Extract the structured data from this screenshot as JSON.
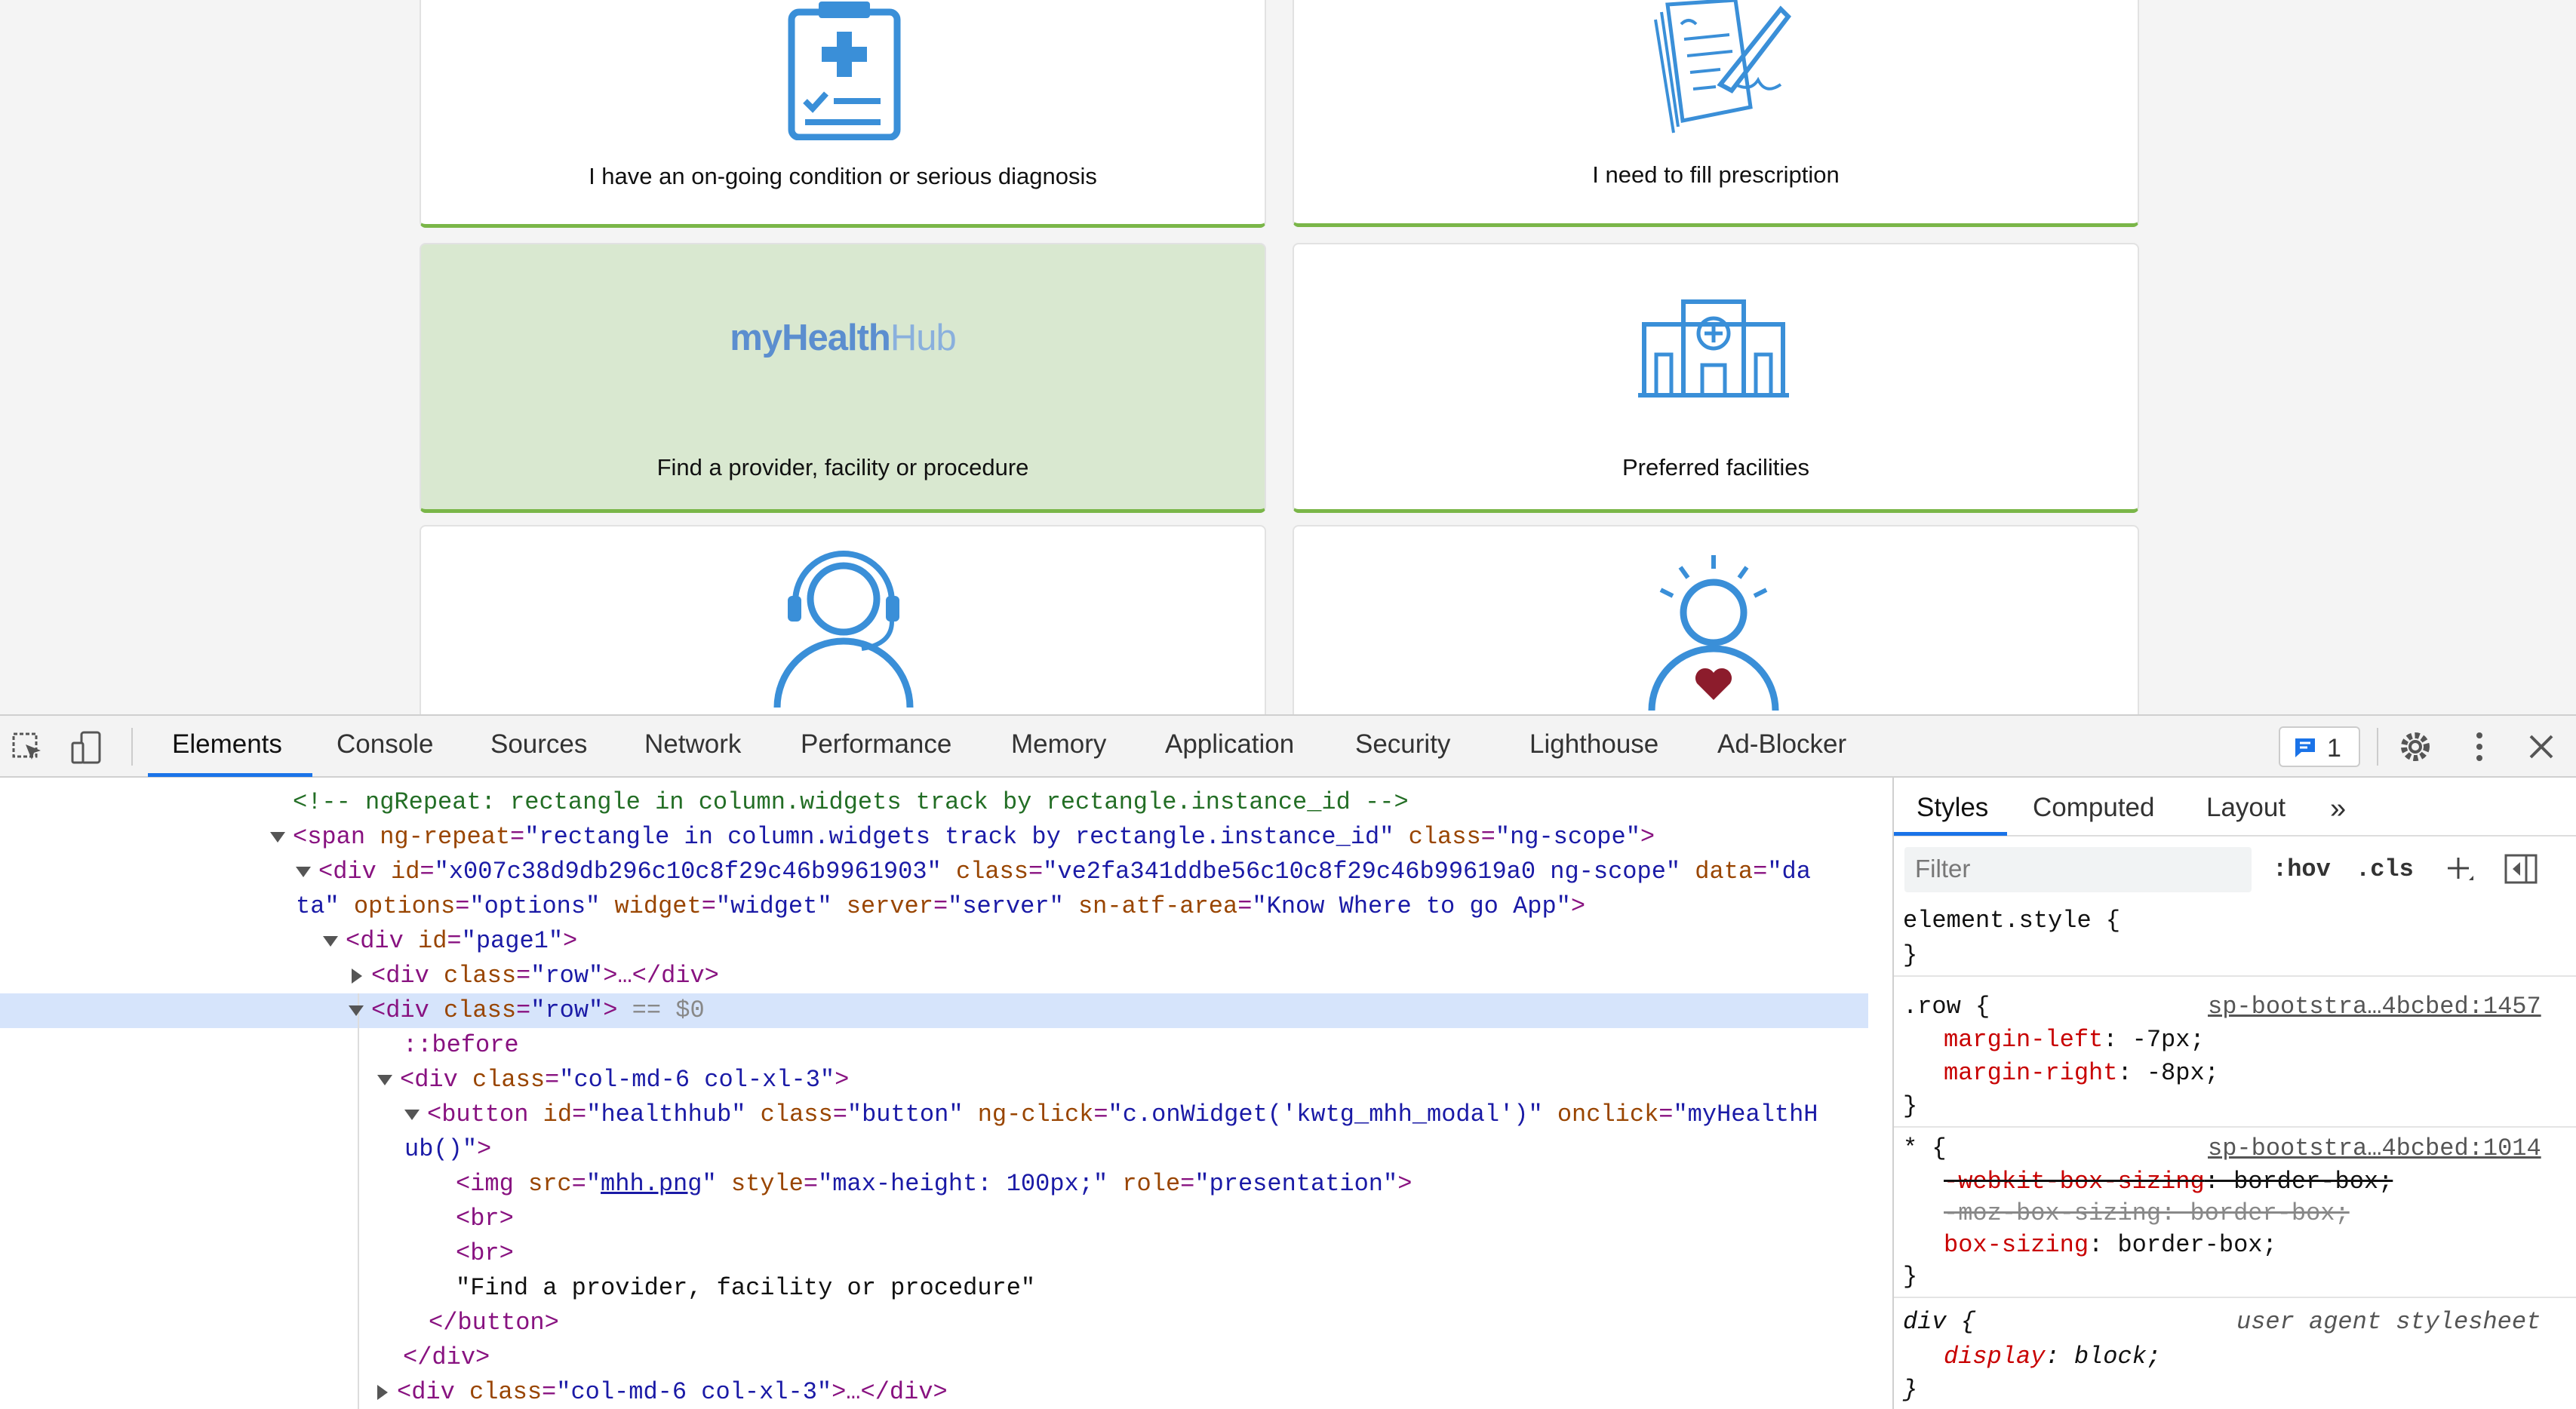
{
  "page": {
    "cards": [
      {
        "label": "I have an on-going condition or serious diagnosis",
        "icon": "clipboard-medical-icon"
      },
      {
        "label": "I need to fill prescription",
        "icon": "prescription-pad-icon"
      },
      {
        "label": "Find a provider, facility or procedure",
        "logo_main": "myHealth",
        "logo_sub": "Hub",
        "highlighted": true
      },
      {
        "label": "Preferred facilities",
        "icon": "hospital-building-icon"
      },
      {
        "label": "",
        "icon": "headset-support-icon"
      },
      {
        "label": "",
        "icon": "person-heart-icon"
      }
    ],
    "accent": "#7ab648",
    "icon_color": "#3a8fd8"
  },
  "devtools": {
    "tabs": [
      "Elements",
      "Console",
      "Sources",
      "Network",
      "Performance",
      "Memory",
      "Application",
      "Security",
      "Lighthouse",
      "Ad-Blocker"
    ],
    "active_tab": "Elements",
    "issues_count": "1",
    "dom_lines": {
      "l1": "<!-- ngRepeat: rectangle in column.widgets track by rectangle.instance_id -->",
      "l2_tag": "<span",
      "l2_a1": " ng-repeat",
      "l2_v1": "\"rectangle in column.widgets track by rectangle.instance_id\"",
      "l2_a2": " class",
      "l2_v2": "\"ng-scope\"",
      "l2_end": ">",
      "l3_tag": "<div",
      "l3_a1": " id",
      "l3_v1": "\"x007c38d9db296c10c8f29c46b9961903\"",
      "l3_a2": " class",
      "l3_v2": "\"ve2fa341ddbe56c10c8f29c46b99619a0 ng-scope\"",
      "l3_a3": " data",
      "l3_v3": "\"da",
      "l4_v": "ta\"",
      "l4_a1": " options",
      "l4_v1": "\"options\"",
      "l4_a2": " widget",
      "l4_v2": "\"widget\"",
      "l4_a3": " server",
      "l4_v3": "\"server\"",
      "l4_a4": " sn-atf-area",
      "l4_v4": "\"Know Where to go App\"",
      "l4_end": ">",
      "l5_tag": "<div",
      "l5_a1": " id",
      "l5_v1": "\"page1\"",
      "l5_end": ">",
      "l6_tag": "<div",
      "l6_a1": " class",
      "l6_v1": "\"row\"",
      "l6_end": ">…</div>",
      "l7_tag": "<div",
      "l7_a1": " class",
      "l7_v1": "\"row\"",
      "l7_end": ">",
      "l7_eq": " == $0",
      "l8": "::before",
      "l9_tag": "<div",
      "l9_a1": " class",
      "l9_v1": "\"col-md-6 col-xl-3\"",
      "l9_end": ">",
      "l10_tag": "<button",
      "l10_a1": " id",
      "l10_v1": "\"healthhub\"",
      "l10_a2": " class",
      "l10_v2": "\"button\"",
      "l10_a3": " ng-click",
      "l10_v3": "\"c.onWidget('kwtg_mhh_modal')\"",
      "l10_a4": " onclick",
      "l10_v4": "\"myHealthH",
      "l11": "ub()\"",
      "l11_end": ">",
      "l12_tag": "<img",
      "l12_a1": " src",
      "l12_q1": "\"",
      "l12_link": "mhh.png",
      "l12_q2": "\"",
      "l12_a2": " style",
      "l12_v2": "\"max-height: 100px;\"",
      "l12_a3": " role",
      "l12_v3": "\"presentation\"",
      "l12_end": ">",
      "l13": "<br>",
      "l14": "<br>",
      "l15": "\"Find a provider, facility or procedure\"",
      "l16": "</button>",
      "l17": "</div>",
      "l18_tag": "<div",
      "l18_a1": " class",
      "l18_v1": "\"col-md-6 col-xl-3\"",
      "l18_end": ">…</div>"
    },
    "styles": {
      "tabs": [
        "Styles",
        "Computed",
        "Layout"
      ],
      "filter_placeholder": "Filter",
      "hov": ":hov",
      "cls": ".cls",
      "element_style": "element.style {",
      "close_brace": "}",
      "rule1_selector": ".row {",
      "rule1_source": "sp-bootstra…4bcbed:1457",
      "rule1_p1": "margin-left",
      "rule1_v1": ": -7px;",
      "rule1_p2": "margin-right",
      "rule1_v2": ": -8px;",
      "rule2_selector": "* {",
      "rule2_source": "sp-bootstra…4bcbed:1014",
      "rule2_p1": "-webkit-box-sizing",
      "rule2_v1": ": border-box;",
      "rule2_p2": "-moz-box-sizing: border-box;",
      "rule2_p3": "box-sizing",
      "rule2_v3": ": border-box;",
      "rule3_selector": "div {",
      "rule3_source": "user agent stylesheet",
      "rule3_p1": "display",
      "rule3_v1": ": block;"
    }
  }
}
